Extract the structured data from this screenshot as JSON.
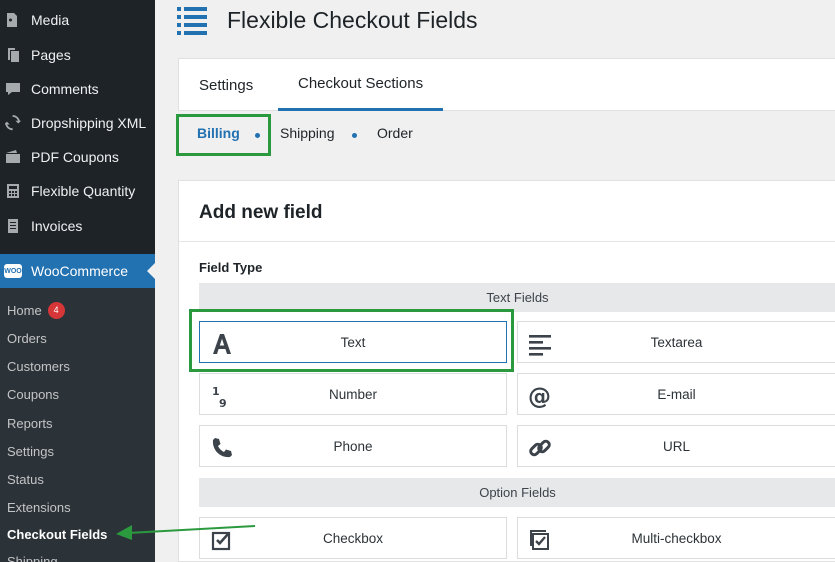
{
  "sidebar": {
    "items": [
      {
        "label": "Media",
        "icon": "media-icon"
      },
      {
        "label": "Pages",
        "icon": "pages-icon"
      },
      {
        "label": "Comments",
        "icon": "comments-icon"
      },
      {
        "label": "Dropshipping XML",
        "icon": "sync-icon"
      },
      {
        "label": "PDF Coupons",
        "icon": "coupons-icon"
      },
      {
        "label": "Flexible Quantity",
        "icon": "calculator-icon"
      },
      {
        "label": "Invoices",
        "icon": "invoice-icon"
      }
    ],
    "woocommerce": {
      "label": "WooCommerce",
      "badge": "WOO"
    },
    "submenu": [
      {
        "label": "Home",
        "count": "4"
      },
      {
        "label": "Orders"
      },
      {
        "label": "Customers"
      },
      {
        "label": "Coupons"
      },
      {
        "label": "Reports"
      },
      {
        "label": "Settings"
      },
      {
        "label": "Status"
      },
      {
        "label": "Extensions"
      },
      {
        "label": "Checkout Fields",
        "current": true
      },
      {
        "label": "Shipping"
      }
    ]
  },
  "header": {
    "title": "Flexible Checkout Fields",
    "icon": "list-icon"
  },
  "tabs": [
    {
      "label": "Settings"
    },
    {
      "label": "Checkout Sections",
      "active": true
    }
  ],
  "subtabs": [
    {
      "label": "Billing",
      "active": true
    },
    {
      "label": "Shipping"
    },
    {
      "label": "Order"
    }
  ],
  "panel": {
    "title": "Add new field",
    "field_type_label": "Field Type",
    "sections": [
      {
        "name": "Text Fields",
        "fields": [
          {
            "label": "Text",
            "icon": "text-a-icon",
            "selected": true
          },
          {
            "label": "Textarea",
            "icon": "align-left-icon"
          },
          {
            "label": "Number",
            "icon": "number-icon"
          },
          {
            "label": "E-mail",
            "icon": "at-icon"
          },
          {
            "label": "Phone",
            "icon": "phone-icon"
          },
          {
            "label": "URL",
            "icon": "link-icon"
          }
        ]
      },
      {
        "name": "Option Fields",
        "fields": [
          {
            "label": "Checkbox",
            "icon": "checkbox-icon"
          },
          {
            "label": "Multi-checkbox",
            "icon": "multi-checkbox-icon"
          }
        ]
      }
    ]
  },
  "colors": {
    "accent": "#2271b1",
    "highlight": "#2b9a3f",
    "sidebar": "#1d2327"
  }
}
